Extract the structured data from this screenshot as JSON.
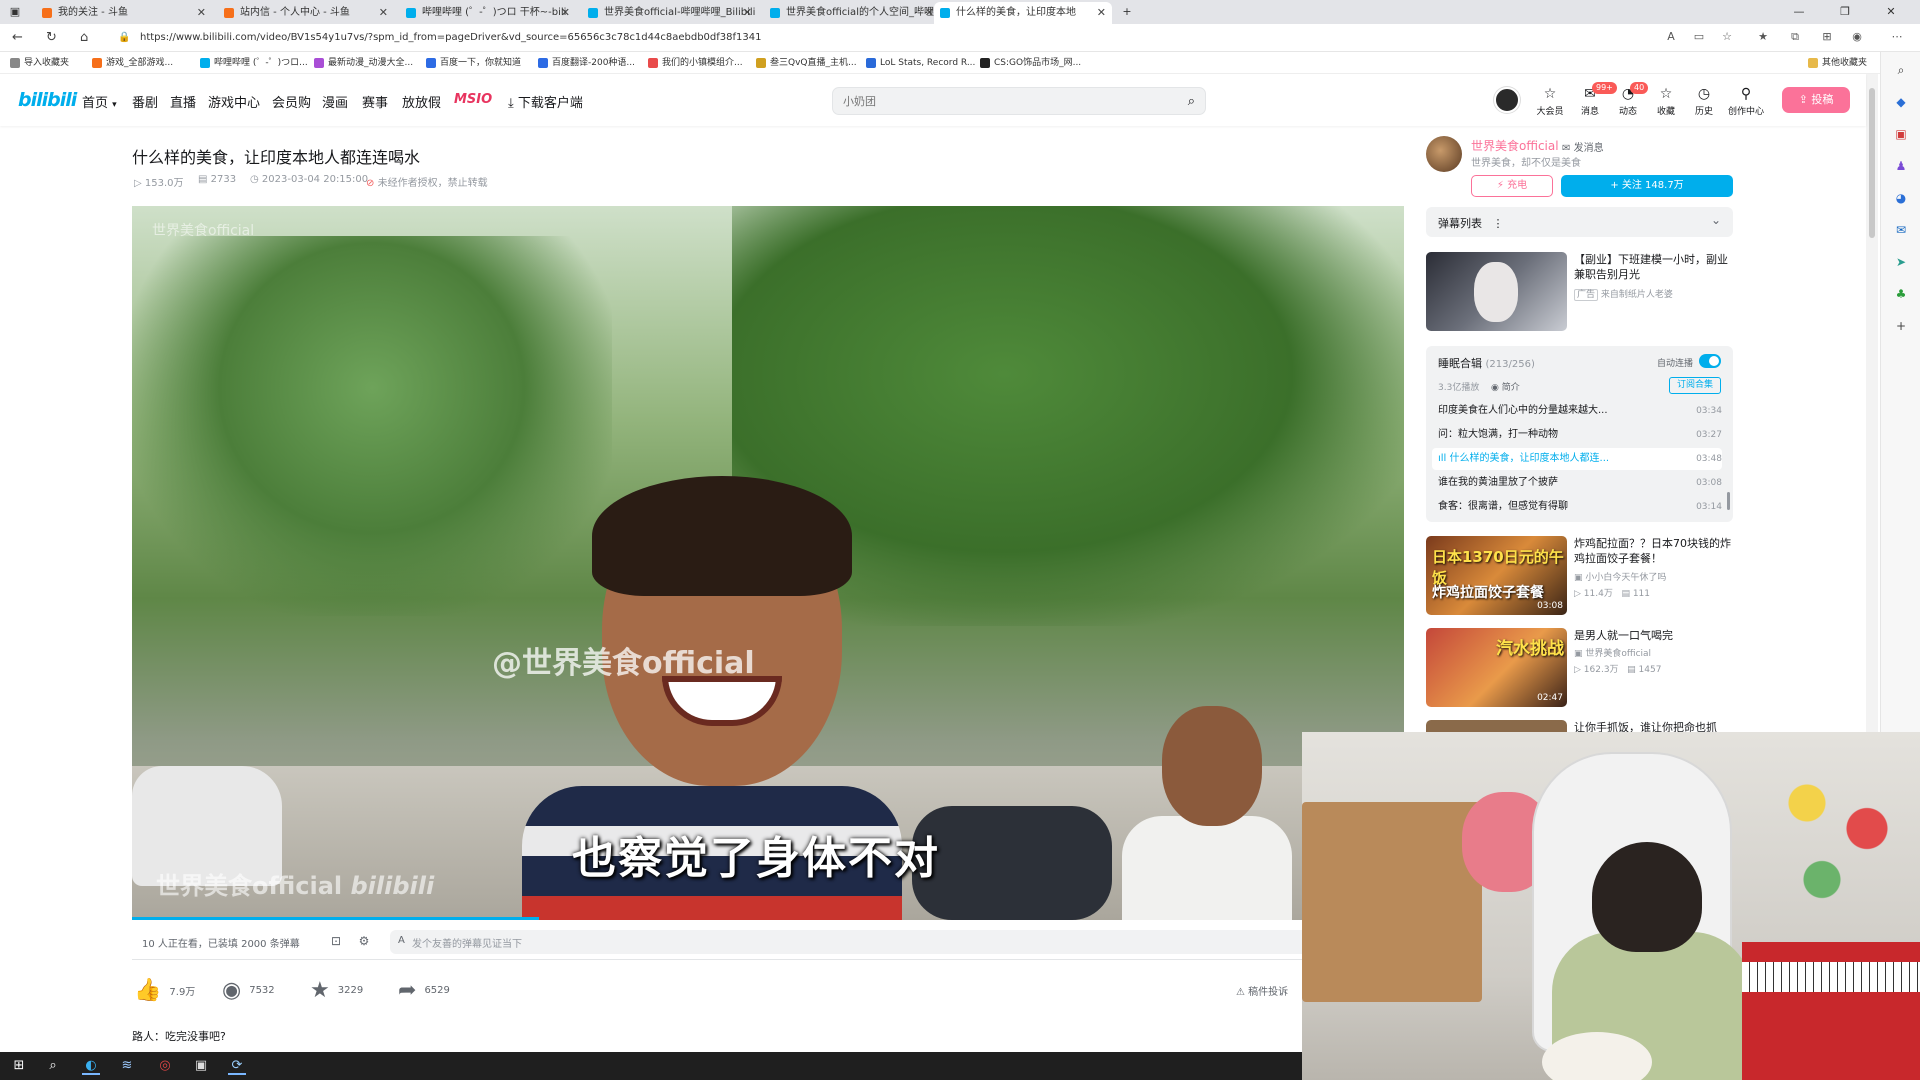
{
  "browser": {
    "tabs": [
      {
        "label": "我的关注 - 斗鱼",
        "color": "#f66f1a"
      },
      {
        "label": "站内信 - 个人中心 - 斗鱼",
        "color": "#f66f1a"
      },
      {
        "label": "哔哩哔哩 (゜-゜)つロ 干杯~-bili",
        "color": "#00aeec"
      },
      {
        "label": "世界美食official-哔哩哔哩_Bilibili",
        "color": "#00aeec"
      },
      {
        "label": "世界美食official的个人空间_哔哩",
        "color": "#00aeec"
      },
      {
        "label": "什么样的美食，让印度本地",
        "color": "#00aeec"
      }
    ],
    "new_tab": "+",
    "window_controls": [
      "—",
      "❐",
      "✕"
    ],
    "url": "https://www.bilibili.com/video/BV1s54y1u7vs/?spm_id_from=pageDriver&vd_source=65656c3c78c1d44c8aebdb0df38f1341",
    "bookmarks": [
      {
        "label": "导入收藏夹",
        "color": "#888"
      },
      {
        "label": "游戏_全部游戏...",
        "color": "#f66f1a"
      },
      {
        "label": "哔哩哔哩 (゜-゜)つロ...",
        "color": "#00aeec"
      },
      {
        "label": "最新动漫_动漫大全...",
        "color": "#a94ed6"
      },
      {
        "label": "百度一下，你就知道",
        "color": "#2d6be4"
      },
      {
        "label": "百度翻译-200种语...",
        "color": "#2d6be4"
      },
      {
        "label": "我们的小镇模组介...",
        "color": "#e94b4b"
      },
      {
        "label": "叁三QvQ直播_主机...",
        "color": "#d0a020"
      },
      {
        "label": "LoL Stats, Record R...",
        "color": "#2a6ad9"
      },
      {
        "label": "CS:GO饰品市场_网...",
        "color": "#222"
      }
    ],
    "other_bookmarks": "其他收藏夹"
  },
  "header": {
    "logo": "bilibili",
    "nav": [
      "首页",
      "番剧",
      "直播",
      "游戏中心",
      "会员购",
      "漫画",
      "赛事",
      "放放假",
      "MSIO",
      "下载客户端"
    ],
    "search_placeholder": "小奶团",
    "icons": [
      {
        "icon": "☆",
        "label": "大会员",
        "badge": ""
      },
      {
        "icon": "✉",
        "label": "消息",
        "badge": "99+"
      },
      {
        "icon": "◔",
        "label": "动态",
        "badge": "40"
      },
      {
        "icon": "☆",
        "label": "收藏",
        "badge": ""
      },
      {
        "icon": "◷",
        "label": "历史",
        "badge": ""
      },
      {
        "icon": "⚲",
        "label": "创作中心",
        "badge": ""
      }
    ],
    "upload": "投稿"
  },
  "video": {
    "title": "什么样的美食，让印度本地人都连连喝水",
    "plays": "153.0万",
    "danmaku_count": "2733",
    "date": "2023-03-04 20:15:00",
    "copyright": "未经作者授权，禁止转载",
    "watermark_center": "@世界美食official",
    "watermark_left": "世界美食official",
    "subtitle": "也察觉了身体不对",
    "progress": 0.32
  },
  "danmaku_bar": {
    "status": "10 人正在看，已装填 2000 条弹幕",
    "placeholder": "发个友善的弹幕见证当下"
  },
  "actions": {
    "like": "7.9万",
    "coin": "7532",
    "fav": "3229",
    "share": "6529",
    "report": "稿件投诉"
  },
  "comment_preview": "路人：吃完没事吧?",
  "uploader": {
    "name": "世界美食official",
    "message": "发消息",
    "desc": "世界美食，却不仅是美食",
    "charge": "充电",
    "follow": "+ 关注 148.7万"
  },
  "danmaku_list": {
    "title": "弹幕列表",
    "menu": "⋮",
    "chevron": "⌄"
  },
  "ad": {
    "title": "【副业】下班建模一小时，副业兼职告别月光",
    "sub": "来自制纸片人老婆"
  },
  "playlist": {
    "title": "睡眠合辑",
    "count": "(213/256)",
    "autoplay": "自动连播",
    "plays": "3.3亿播放",
    "intro": "简介",
    "subscribe": "订阅合集",
    "items": [
      {
        "title": "印度美食在人们心中的分量越来越大...",
        "dur": "03:34",
        "current": false
      },
      {
        "title": "问：粒大饱满，打一种动物",
        "dur": "03:27",
        "current": false
      },
      {
        "title": "什么样的美食，让印度本地人都连...",
        "dur": "03:48",
        "current": true
      },
      {
        "title": "谁在我的黄油里放了个披萨",
        "dur": "03:08",
        "current": false
      },
      {
        "title": "食客：很离谱，但感觉有得聊",
        "dur": "03:14",
        "current": false
      }
    ]
  },
  "recommendations": [
    {
      "title": "炸鸡配拉面？？日本70块钱的炸鸡拉面饺子套餐！",
      "author": "小小白今天午休了吗",
      "views": "11.4万",
      "danmaku": "111",
      "dur": "03:08",
      "thumb_text": "日本1370日元的午饭\n炸鸡拉面饺子套餐"
    },
    {
      "title": "是男人就一口气喝完",
      "author": "世界美食official",
      "views": "162.3万",
      "danmaku": "1457",
      "dur": "02:47",
      "thumb_text": "汽水挑战"
    },
    {
      "title": "让你手抓饭，谁让你把命也抓",
      "author": "",
      "views": "",
      "danmaku": "",
      "dur": "",
      "thumb_text": ""
    }
  ],
  "colors": {
    "bili_blue": "#00aeec",
    "bili_pink": "#fb7299"
  }
}
